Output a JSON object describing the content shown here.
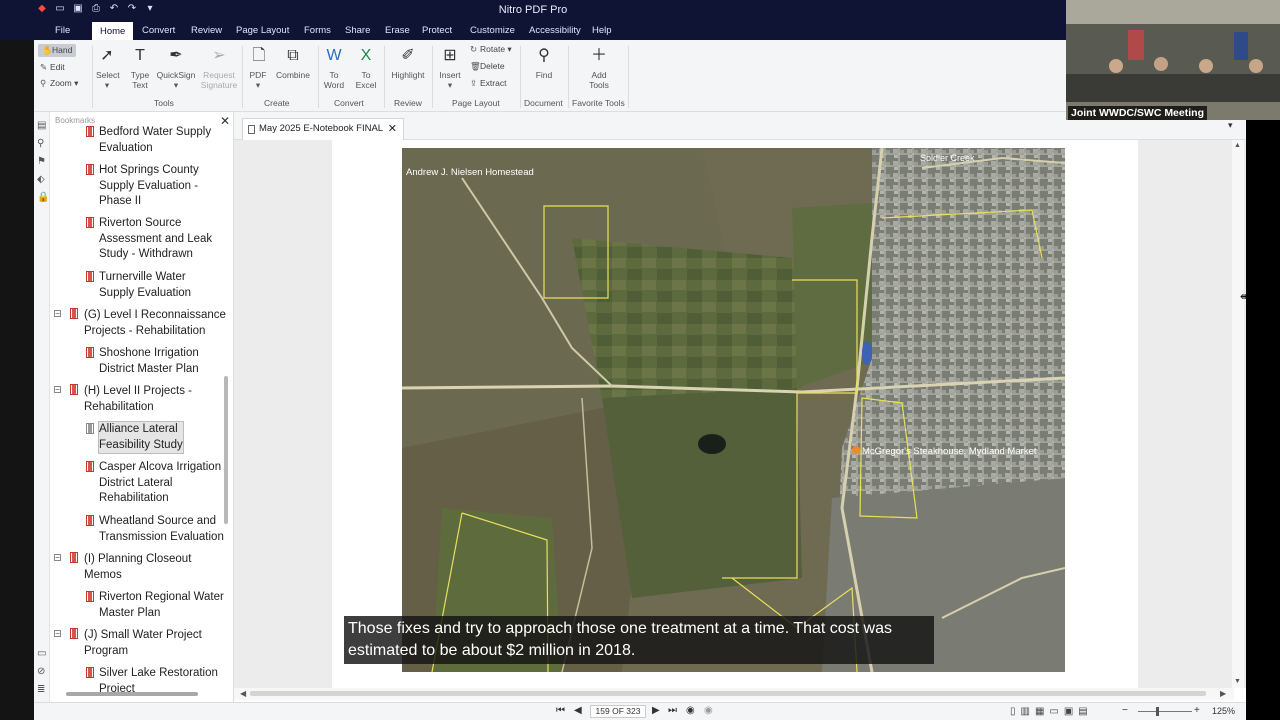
{
  "app": {
    "title": "Nitro PDF Pro",
    "menu_tabs": [
      "File",
      "Home",
      "Convert",
      "Review",
      "Page Layout",
      "Forms",
      "Share",
      "Erase",
      "Protect",
      "Customize",
      "Accessibility",
      "Help"
    ],
    "active_tab": "Home"
  },
  "ribbon": {
    "left_tools": {
      "hand": "Hand",
      "edit": "Edit",
      "zoom": "Zoom"
    },
    "tools": {
      "select": "Select",
      "type_text": "Type\nText",
      "quicksign": "QuickSign",
      "request_signature": "Request\nSignature",
      "group": "Tools"
    },
    "create": {
      "pdf": "PDF",
      "combine": "Combine",
      "group": "Create"
    },
    "convert": {
      "to_word": "To\nWord",
      "to_excel": "To\nExcel",
      "group": "Convert"
    },
    "review": {
      "highlight": "Highlight",
      "group": "Review"
    },
    "page_layout": {
      "insert": "Insert",
      "rotate": "Rotate",
      "delete": "Delete",
      "extract": "Extract",
      "group": "Page Layout"
    },
    "document": {
      "find": "Find",
      "group": "Document"
    },
    "favorite": {
      "add_tools": "Add\nTools",
      "group": "Favorite Tools"
    }
  },
  "bookmarks": {
    "header": "Bookmarks",
    "items": [
      {
        "label": "Bedford Water Supply\nEvaluation",
        "level": 2
      },
      {
        "label": "Hot Springs County\nSupply Evaluation -\nPhase II",
        "level": 2
      },
      {
        "label": "Riverton Source\nAssessment and Leak\nStudy - Withdrawn",
        "level": 2
      },
      {
        "label": "Turnerville Water\nSupply Evaluation",
        "level": 2
      },
      {
        "label": "(G) Level I Reconnaissance\nProjects - Rehabilitation",
        "level": 1
      },
      {
        "label": "Shoshone Irrigation\nDistrict Master Plan",
        "level": 2
      },
      {
        "label": "(H) Level II Projects -\nRehabilitation",
        "level": 1
      },
      {
        "label": "Alliance Lateral\nFeasibility Study",
        "level": 2,
        "selected": true
      },
      {
        "label": "Casper Alcova Irrigation\nDistrict Lateral\nRehabilitation",
        "level": 2
      },
      {
        "label": "Wheatland Source and\nTransmission Evaluation",
        "level": 2
      },
      {
        "label": "(I) Planning Closeout\nMemos",
        "level": 1
      },
      {
        "label": "Riverton Regional Water\nMaster Plan",
        "level": 2
      },
      {
        "label": "(J) Small Water Project\nProgram",
        "level": 1
      },
      {
        "label": "Silver Lake Restoration\nProject",
        "level": 2
      }
    ]
  },
  "document": {
    "tab_name": "May 2025 E-Notebook FINAL",
    "map_labels": {
      "soldier_creek": "Soldier Creek",
      "homestead": "Andrew J. Nielsen Homestead",
      "poi": "McGregor's Steakhouse, Mydland Market"
    },
    "caption": "Those fixes and try to approach those one treatment at a time. That cost was estimated to be about $2 million in 2018."
  },
  "status": {
    "page_indicator": "159 OF 323",
    "zoom": "125%"
  },
  "video": {
    "label": "Joint WWDC/SWC Meeting"
  },
  "colors": {
    "titlebar": "#0f1334",
    "accent_red": "#d9534f",
    "boundary": "#e8e05a"
  }
}
